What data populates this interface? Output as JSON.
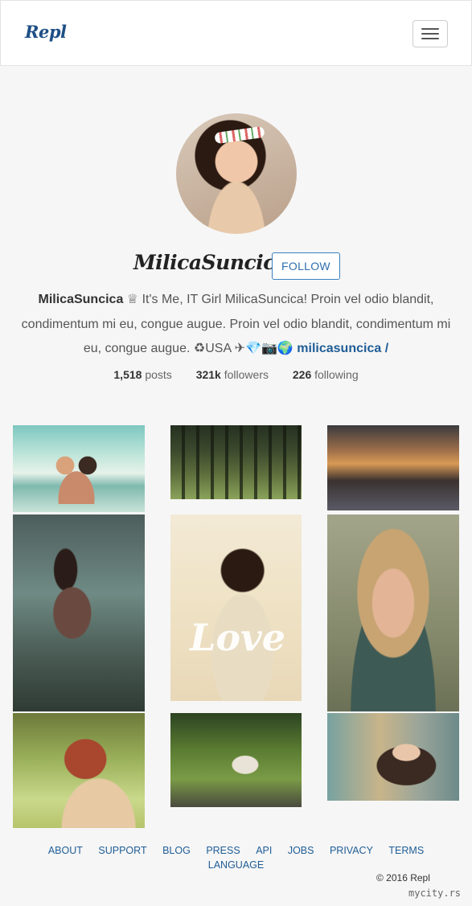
{
  "navbar": {
    "brand": "Repl"
  },
  "profile": {
    "username": "MilicaSuncica",
    "follow_label": "FOLLOW",
    "bio_name": "MilicaSuncica",
    "bio_text": " ♕ It's Me, IT Girl MilicaSuncica! Proin vel odio blandit, condimentum mi eu, congue augue. Proin vel odio blandit, condimentum mi eu, congue augue. ♻USA ✈💎📷🌍 ",
    "bio_link": "milicasuncica /",
    "stats": {
      "posts_count": "1,518",
      "posts_label": "posts",
      "followers_count": "321k",
      "followers_label": "followers",
      "following_count": "226",
      "following_label": "following"
    }
  },
  "gallery": {
    "overlay_text": "Love"
  },
  "footer": {
    "links": [
      "ABOUT",
      "SUPPORT",
      "BLOG",
      "PRESS",
      "API",
      "JOBS",
      "PRIVACY",
      "TERMS",
      "LANGUAGE"
    ],
    "copyright": "© 2016 Repl"
  },
  "watermark": "mycity.rs"
}
